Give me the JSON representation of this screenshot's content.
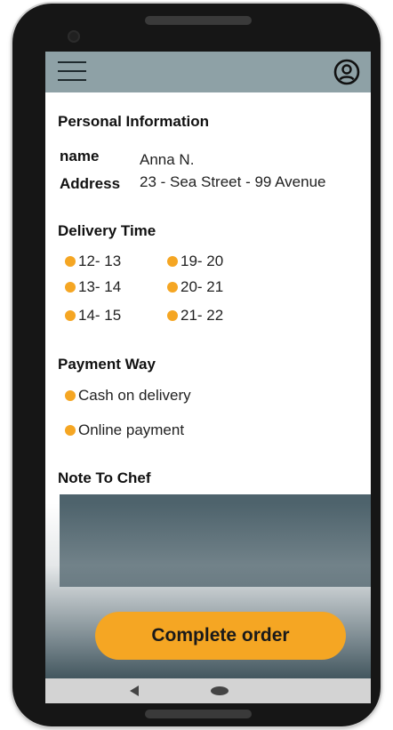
{
  "header": {
    "menu_icon": "hamburger-menu-icon",
    "profile_icon": "user-circle-icon"
  },
  "personal": {
    "title": "Personal Information",
    "name_label": "name",
    "name_value": "Anna N.",
    "address_label": "Address",
    "address_value": "23 - Sea Street - 99 Avenue"
  },
  "delivery": {
    "title": "Delivery Time",
    "slots": [
      "12- 13",
      "13- 14",
      "14- 15",
      "19- 20",
      "20- 21",
      "21- 22"
    ]
  },
  "payment": {
    "title": "Payment Way",
    "options": [
      "Cash on delivery",
      "Online payment"
    ]
  },
  "note": {
    "title": "Note To Chef",
    "value": ""
  },
  "actions": {
    "complete_label": "Complete order"
  },
  "colors": {
    "accent": "#f5a623",
    "appbar": "#8ea1a6",
    "note_box": "#4e636c"
  }
}
